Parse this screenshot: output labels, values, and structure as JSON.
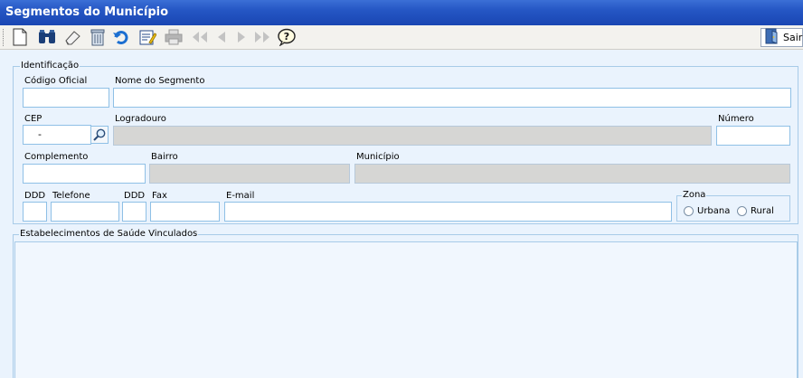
{
  "window": {
    "title": "Segmentos do Município"
  },
  "toolbar": {
    "icons": [
      "new-document-icon",
      "binoculars-search-icon",
      "eraser-icon",
      "trash-icon",
      "undo-icon",
      "edit-note-icon",
      "print-icon",
      "first-record-icon",
      "previous-record-icon",
      "next-record-icon",
      "last-record-icon",
      "help-icon"
    ],
    "exit_label": "Sair"
  },
  "identificacao": {
    "legend": "Identificação",
    "codigo_oficial": {
      "label": "Código Oficial",
      "value": ""
    },
    "nome_segmento": {
      "label": "Nome do Segmento",
      "value": ""
    },
    "cep": {
      "label": "CEP",
      "value": "-"
    },
    "logradouro": {
      "label": "Logradouro",
      "value": ""
    },
    "numero": {
      "label": "Número",
      "value": ""
    },
    "complemento": {
      "label": "Complemento",
      "value": ""
    },
    "bairro": {
      "label": "Bairro",
      "value": ""
    },
    "municipio": {
      "label": "Município",
      "value": ""
    },
    "ddd1": {
      "label": "DDD",
      "value": ""
    },
    "telefone": {
      "label": "Telefone",
      "value": ""
    },
    "ddd2": {
      "label": "DDD",
      "value": ""
    },
    "fax": {
      "label": "Fax",
      "value": ""
    },
    "email": {
      "label": "E-mail",
      "value": ""
    },
    "zona": {
      "legend": "Zona",
      "options": [
        "Urbana",
        "Rural"
      ],
      "selected": ""
    }
  },
  "estabelecimentos": {
    "legend": "Estabelecimentos de Saúde Vinculados"
  }
}
